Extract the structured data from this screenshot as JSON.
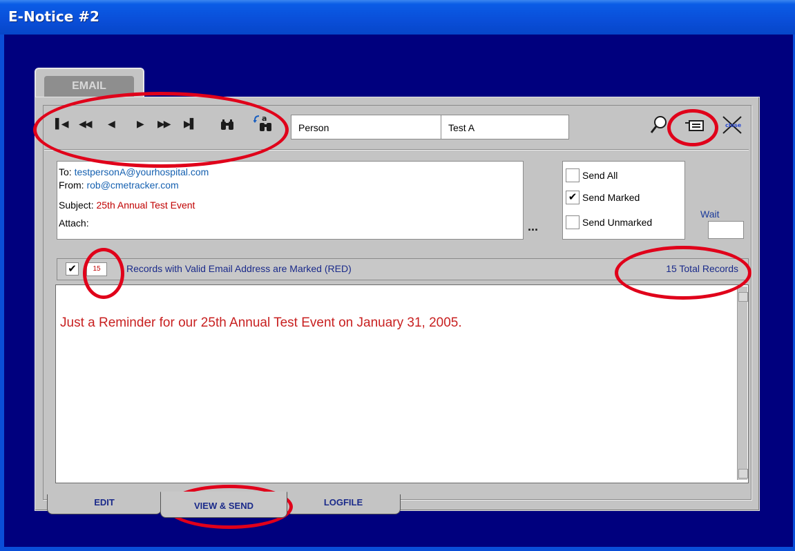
{
  "window": {
    "title": "E-Notice #2"
  },
  "tab_email": "EMAIL",
  "toolbar": {
    "nav": [
      "first-record-icon",
      "prev-page-icon",
      "prev-record-icon",
      "next-record-icon",
      "next-page-icon",
      "last-record-icon"
    ],
    "find_field": "Person",
    "find_value": "Test A"
  },
  "header": {
    "to_label": "To:",
    "to_value": "testpersonA@yourhospital.com",
    "from_label": "From:",
    "from_value": "rob@cmetracker.com",
    "subject_label": "Subject:",
    "subject_value": "25th Annual Test Event",
    "attach_label": "Attach:",
    "browse_label": "..."
  },
  "send_options": {
    "send_all": "Send All",
    "send_marked": "Send Marked",
    "send_unmarked": "Send Unmarked",
    "selected": "Send Marked"
  },
  "wait": {
    "label": "Wait",
    "value": ""
  },
  "status": {
    "marked_count": "15",
    "marked_text": "Records with Valid Email Address are Marked (RED)",
    "total_text": "15 Total Records"
  },
  "message_body": "Just a Reminder for our 25th Annual Test Event on January 31, 2005.",
  "bottom_tabs": [
    "EDIT",
    "VIEW & SEND",
    "LOGFILE"
  ],
  "active_tab": "VIEW & SEND",
  "colors": {
    "title_bar": "#0a4ed8",
    "client_bg": "#00007e",
    "panel": "#c4c4c4",
    "annotation": "#e0001a",
    "body_text": "#c82020",
    "link_blue": "#1560b0"
  }
}
